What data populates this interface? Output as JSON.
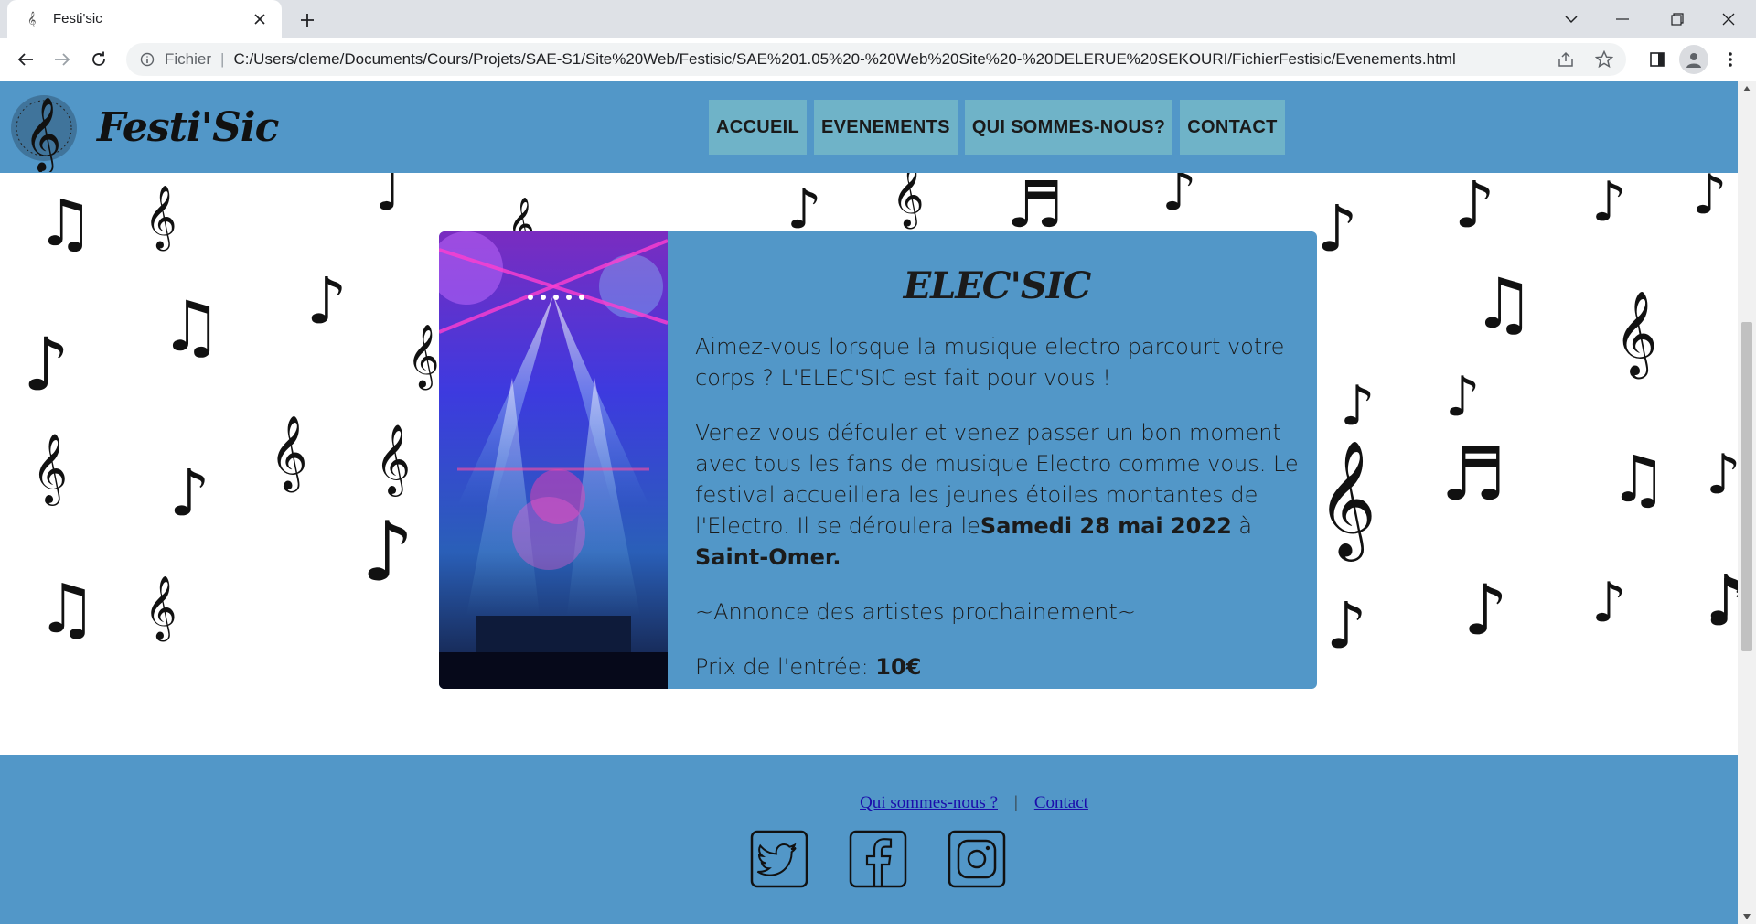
{
  "browser": {
    "tab_title": "Festi'sic",
    "url_scheme": "Fichier",
    "url": "C:/Users/cleme/Documents/Cours/Projets/SAE-S1/Site%20Web/Festisic/SAE%201.05%20-%20Web%20Site%20-%20DELERUE%20SEKOURI/FichierFestisic/Evenements.html"
  },
  "header": {
    "logo_text": "Festi'Sic",
    "nav": [
      "ACCUEIL",
      "EVENEMENTS",
      "QUI SOMMES-NOUS?",
      "CONTACT"
    ]
  },
  "event": {
    "title": "ELEC'SIC",
    "intro": "Aimez-vous lorsque la musique electro parcourt votre corps ? L'ELEC'SIC est fait pour vous !",
    "body": "Venez vous défouler et venez passer un bon moment avec tous les fans de musique Electro comme vous. Le festival accueillera les jeunes étoiles montantes de l'Electro. Il se déroulera le",
    "date": "Samedi 28 mai 2022",
    "date_connector": "à",
    "place": "Saint-Omer.",
    "artists": "~Annonce des artistes prochainement~",
    "price_label": "Prix de l'entrée:",
    "price": "10€"
  },
  "footer": {
    "links": [
      "Qui sommes-nous ?",
      "Contact"
    ],
    "separator": "|",
    "socials": [
      "twitter-icon",
      "facebook-icon",
      "instagram-icon"
    ]
  },
  "colors": {
    "brand_blue": "#5297c8",
    "nav_button": "#6fb3c8",
    "link": "#1a0dab"
  }
}
